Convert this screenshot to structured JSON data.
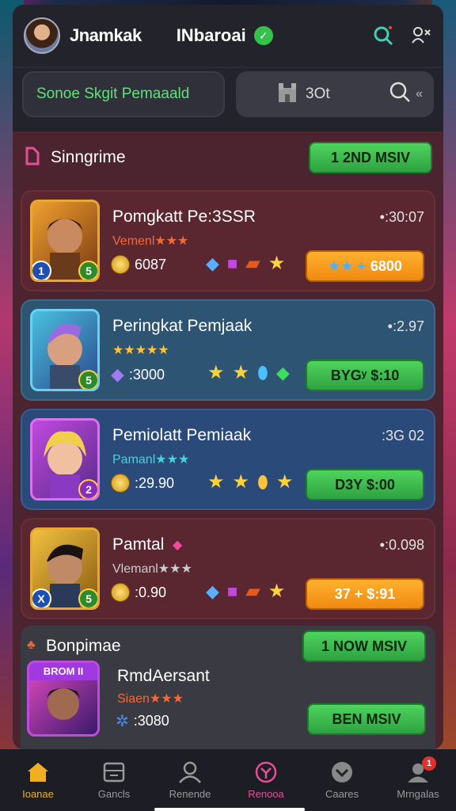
{
  "header": {
    "username": "Jnamkak",
    "brand": "INbaroai",
    "icons": [
      "search-icon",
      "user-switch-icon"
    ]
  },
  "tabs": {
    "left_label": "Sonoe Skgit Pemaaald",
    "right_label": "3Ot"
  },
  "section": {
    "title": "Sinngrime",
    "button_label": "1 2ND MSIV"
  },
  "cards": [
    {
      "name": "Pomgkatt Pe:3SSR",
      "time": "•:30:07",
      "rank": "Vemenl★★★",
      "coins": "6087",
      "action": "6800",
      "action_prefix": "★★ +",
      "badge_l": "1",
      "badge_r": "5"
    },
    {
      "name": "Peringkat Pemjaak",
      "time": "•:2.97",
      "rank": "★★★★★",
      "coins": ":3000",
      "action": "BYGʸ $:10",
      "badge_r": "5"
    },
    {
      "name": "Pemiolatt Pemiaak",
      "time": ":3G 02",
      "rank": "Pamanl★★★",
      "coins": ":29.90",
      "action": "D3Y $:00",
      "badge_r": "2"
    },
    {
      "name": "Pamtal",
      "time": "•:0.098",
      "rank": "Vlemanl★★★",
      "coins": ":0.90",
      "action": "37 + $:91",
      "badge_l": "X",
      "badge_r": "5"
    }
  ],
  "bottom_section": {
    "title": "Bonpimae",
    "button_label": "1 NOW MSIV",
    "tag": "BROM II",
    "name": "RmdAersant",
    "rank": "Siaen★★★",
    "coins": ":3080",
    "action": "BEN MSIV"
  },
  "nav": [
    {
      "label": "Ioanae",
      "icon": "home-icon"
    },
    {
      "label": "Gancls",
      "icon": "games-icon"
    },
    {
      "label": "Renende",
      "icon": "profile-icon"
    },
    {
      "label": "Renooa",
      "icon": "rewards-icon"
    },
    {
      "label": "Caares",
      "icon": "chevron-down-icon"
    },
    {
      "label": "Mrngalas",
      "icon": "messages-icon",
      "badge": "1"
    }
  ],
  "colors": {
    "accent_green": "#4fd35e",
    "accent_orange": "#f59a18",
    "active_nav": "#f0b022"
  }
}
